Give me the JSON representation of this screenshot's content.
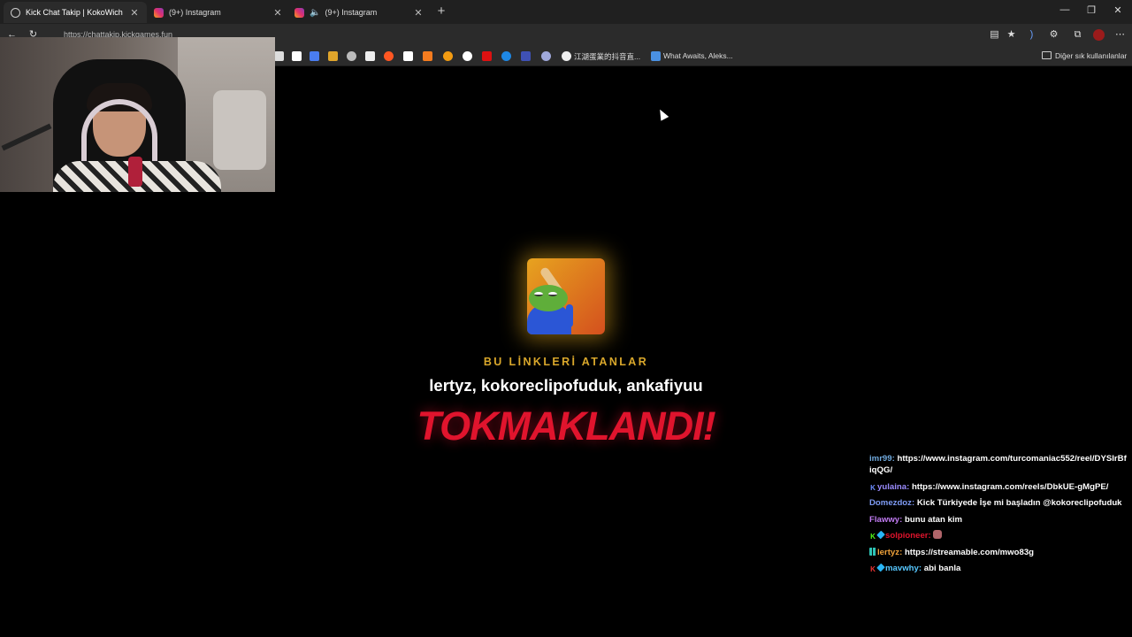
{
  "browser": {
    "tabs": [
      {
        "title": "Kick Chat Takip | KokoWich",
        "active": true
      },
      {
        "title": "(9+) Instagram",
        "active": false
      },
      {
        "title": "(9+) Instagram",
        "active": false,
        "audio": true
      }
    ],
    "url": "https://chattakip.kickgames.fun",
    "bookmarks": [
      {
        "label": "江湖蛋業的抖音直..."
      },
      {
        "label": "What Awaits, Aleks..."
      }
    ],
    "other_bookmarks_label": "Diğer sık kullanılanlar"
  },
  "alert": {
    "subtitle": "BU LİNKLERİ ATANLAR",
    "names": "lertyz, kokoreclipofuduk, ankafiyuu",
    "title": "TOKMAKLANDI!"
  },
  "chat": [
    {
      "user": "imr99",
      "color": "#6fa8dc",
      "text": "https://www.instagram.com/turcomaniac552/reel/DYSIrBfiqQG/",
      "badges": []
    },
    {
      "user": "yulaina",
      "color": "#9b8cff",
      "text": "https://www.instagram.com/reels/DbkUE-gMgPE/",
      "badges": [
        "k-blue"
      ]
    },
    {
      "user": "Domezdoz",
      "color": "#7f9cf5",
      "text": "Kick Türkiyede İşe mi başladın @kokoreclipofuduk",
      "badges": []
    },
    {
      "user": "Flawwy",
      "color": "#c27cf3",
      "text": "bunu atan kim",
      "badges": []
    },
    {
      "user": "solpioneer",
      "color": "#e0142d",
      "text": "",
      "badges": [
        "k",
        "gem"
      ],
      "emote": true
    },
    {
      "user": "lertyz",
      "color": "#f1a33b",
      "text": "https://streamable.com/mwo83g",
      "badges": [
        "grid"
      ]
    },
    {
      "user": "mavwhy",
      "color": "#57c8ff",
      "text": "abi banla",
      "badges": [
        "k-red",
        "gem"
      ]
    }
  ],
  "colors": {
    "alert_red": "#e0142d",
    "alert_gold": "#d9a72b",
    "browser_bg": "#2b2b2b"
  }
}
